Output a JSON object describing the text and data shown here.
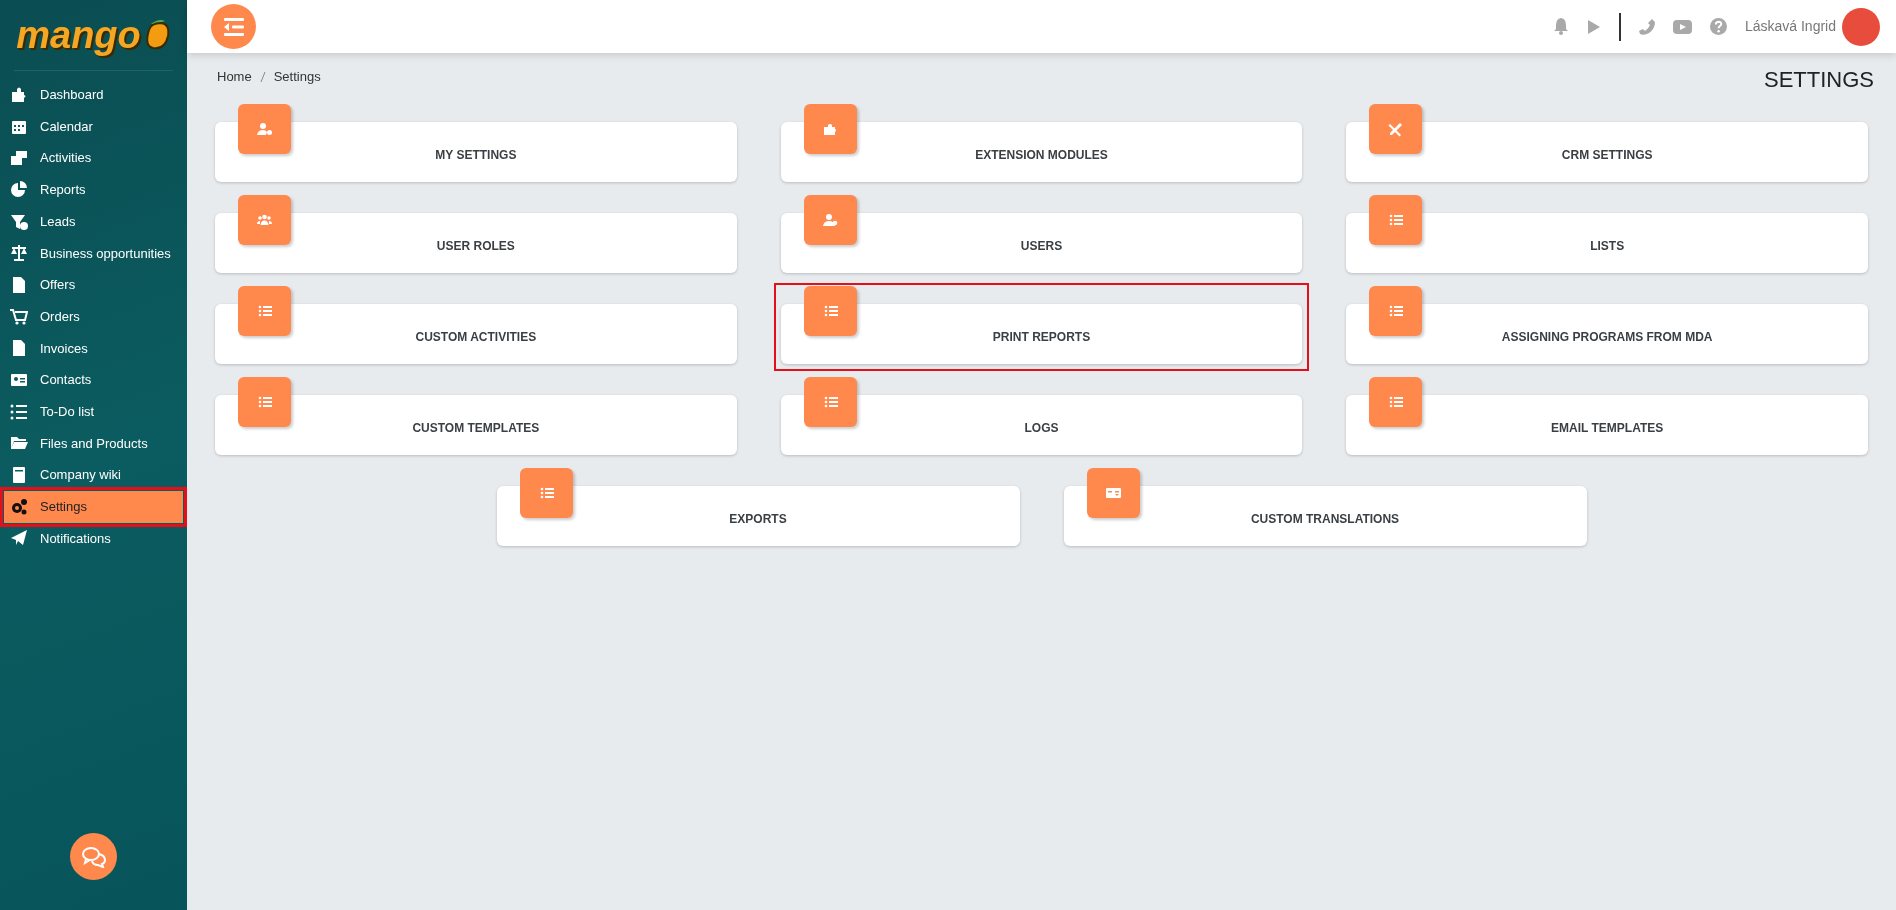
{
  "logo": {
    "text": "mango"
  },
  "sidebar": {
    "items": [
      {
        "label": "Dashboard",
        "selected": false,
        "highlighted": false
      },
      {
        "label": "Calendar",
        "selected": false,
        "highlighted": false
      },
      {
        "label": "Activities",
        "selected": false,
        "highlighted": false
      },
      {
        "label": "Reports",
        "selected": false,
        "highlighted": false
      },
      {
        "label": "Leads",
        "selected": false,
        "highlighted": false
      },
      {
        "label": "Business opportunities",
        "selected": false,
        "highlighted": false
      },
      {
        "label": "Offers",
        "selected": false,
        "highlighted": false
      },
      {
        "label": "Orders",
        "selected": false,
        "highlighted": false
      },
      {
        "label": "Invoices",
        "selected": false,
        "highlighted": false
      },
      {
        "label": "Contacts",
        "selected": false,
        "highlighted": false
      },
      {
        "label": "To-Do list",
        "selected": false,
        "highlighted": false
      },
      {
        "label": "Files and Products",
        "selected": false,
        "highlighted": false
      },
      {
        "label": "Company wiki",
        "selected": false,
        "highlighted": false
      },
      {
        "label": "Settings",
        "selected": true,
        "highlighted": true
      },
      {
        "label": "Notifications",
        "selected": false,
        "highlighted": false
      }
    ]
  },
  "header": {
    "user_name": "Láskavá Ingrid"
  },
  "breadcrumb": [
    "Home",
    "Settings"
  ],
  "page_title": "SETTINGS",
  "cards": [
    {
      "label": "MY SETTINGS",
      "highlighted": false
    },
    {
      "label": "EXTENSION MODULES",
      "highlighted": false
    },
    {
      "label": "CRM SETTINGS",
      "highlighted": false
    },
    {
      "label": "USER ROLES",
      "highlighted": false
    },
    {
      "label": "USERS",
      "highlighted": false
    },
    {
      "label": "LISTS",
      "highlighted": false
    },
    {
      "label": "CUSTOM ACTIVITIES",
      "highlighted": false
    },
    {
      "label": "PRINT REPORTS",
      "highlighted": true
    },
    {
      "label": "ASSIGNING PROGRAMS FROM MDA",
      "highlighted": false
    },
    {
      "label": "CUSTOM TEMPLATES",
      "highlighted": false
    },
    {
      "label": "LOGS",
      "highlighted": false
    },
    {
      "label": "EMAIL TEMPLATES",
      "highlighted": false
    },
    {
      "label": "EXPORTS",
      "highlighted": false
    },
    {
      "label": "CUSTOM TRANSLATIONS",
      "highlighted": false
    }
  ]
}
